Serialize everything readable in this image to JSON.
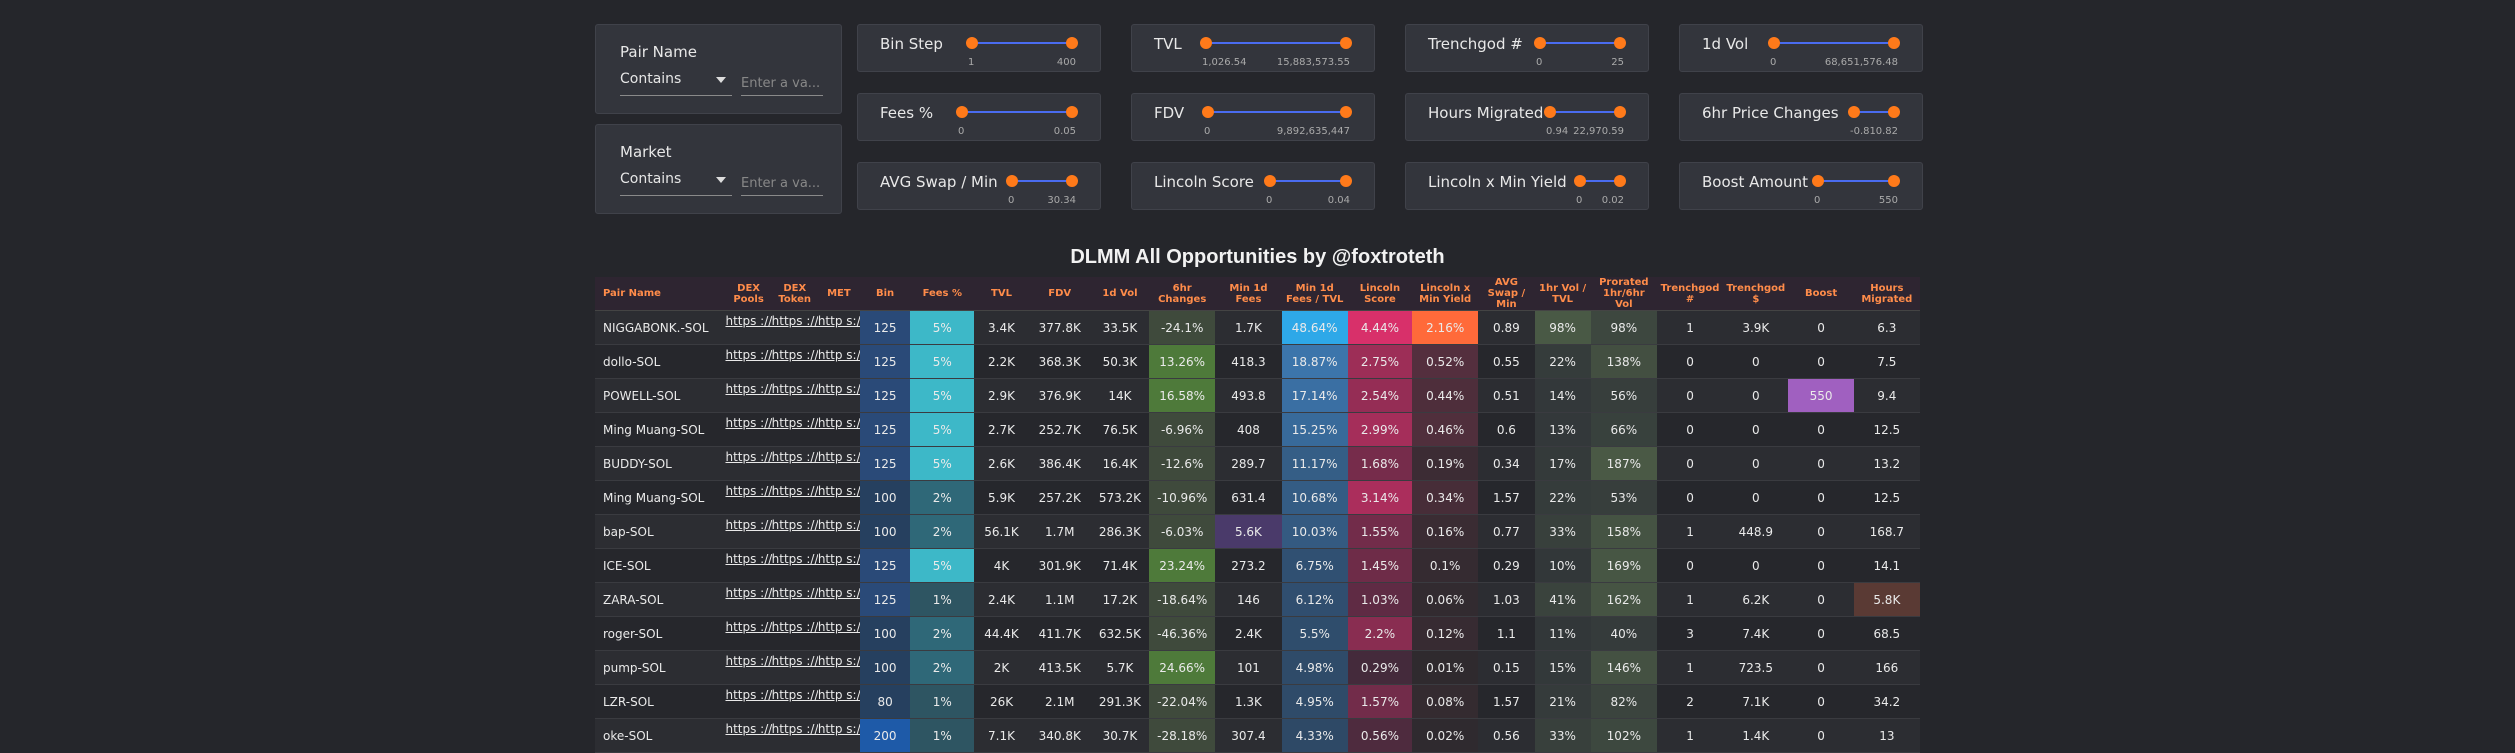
{
  "filters": [
    {
      "label": "Pair Name",
      "select": "Contains",
      "placeholder": "Enter a va..."
    },
    {
      "label": "Market",
      "select": "Contains",
      "placeholder": "Enter a va..."
    }
  ],
  "sliders": [
    {
      "label": "Bin Step",
      "min": "1",
      "max": "400"
    },
    {
      "label": "TVL",
      "min": "1,026.54",
      "max": "15,883,573.55"
    },
    {
      "label": "Trenchgod #",
      "min": "0",
      "max": "25"
    },
    {
      "label": "1d Vol",
      "min": "0",
      "max": "68,651,576.48"
    },
    {
      "label": "Fees %",
      "min": "0",
      "max": "0.05"
    },
    {
      "label": "FDV",
      "min": "0",
      "max": "9,892,635,447"
    },
    {
      "label": "Hours Migrated",
      "min": "0.94",
      "max": "22,970.59"
    },
    {
      "label": "6hr Price Changes",
      "min": "-0.81",
      "max": "0.82"
    },
    {
      "label": "AVG Swap / Min",
      "min": "0",
      "max": "30.34"
    },
    {
      "label": "Lincoln Score",
      "min": "0",
      "max": "0.04"
    },
    {
      "label": "Lincoln x Min Yield",
      "min": "0",
      "max": "0.02"
    },
    {
      "label": "Boost Amount",
      "min": "0",
      "max": "550"
    }
  ],
  "table_title": "DLMM All Opportunities by @foxtroteth",
  "columns": [
    "Pair Name",
    "DEX Pools",
    "DEX Token",
    "MET",
    "Bin",
    "Fees %",
    "TVL",
    "FDV",
    "1d Vol",
    "6hr Changes",
    "Min 1d Fees",
    "Min 1d Fees / TVL",
    "Lincoln Score",
    "Lincoln x Min Yield",
    "AVG Swap / Min",
    "1hr Vol / TVL",
    "Prorated 1hr/6hr Vol",
    "Trenchgod #",
    "Trenchgod $",
    "Boost",
    "Hours Migrated"
  ],
  "link_text": "https ://de",
  "met_text": "http s://a",
  "rows": [
    [
      "NIGGABONK.-SOL",
      "125",
      "5%",
      "3.4K",
      "377.8K",
      "33.5K",
      "-24.1%",
      "1.7K",
      "48.64%",
      "4.44%",
      "2.16%",
      "0.89",
      "98%",
      "98%",
      "1",
      "3.9K",
      "0",
      "6.3"
    ],
    [
      "dollo-SOL",
      "125",
      "5%",
      "2.2K",
      "368.3K",
      "50.3K",
      "13.26%",
      "418.3",
      "18.87%",
      "2.75%",
      "0.52%",
      "0.55",
      "22%",
      "138%",
      "0",
      "0",
      "0",
      "7.5"
    ],
    [
      "POWELL-SOL",
      "125",
      "5%",
      "2.9K",
      "376.9K",
      "14K",
      "16.58%",
      "493.8",
      "17.14%",
      "2.54%",
      "0.44%",
      "0.51",
      "14%",
      "56%",
      "0",
      "0",
      "550",
      "9.4"
    ],
    [
      "Ming Muang-SOL",
      "125",
      "5%",
      "2.7K",
      "252.7K",
      "76.5K",
      "-6.96%",
      "408",
      "15.25%",
      "2.99%",
      "0.46%",
      "0.6",
      "13%",
      "66%",
      "0",
      "0",
      "0",
      "12.5"
    ],
    [
      "BUDDY-SOL",
      "125",
      "5%",
      "2.6K",
      "386.4K",
      "16.4K",
      "-12.6%",
      "289.7",
      "11.17%",
      "1.68%",
      "0.19%",
      "0.34",
      "17%",
      "187%",
      "0",
      "0",
      "0",
      "13.2"
    ],
    [
      "Ming Muang-SOL",
      "100",
      "2%",
      "5.9K",
      "257.2K",
      "573.2K",
      "-10.96%",
      "631.4",
      "10.68%",
      "3.14%",
      "0.34%",
      "1.57",
      "22%",
      "53%",
      "0",
      "0",
      "0",
      "12.5"
    ],
    [
      "bap-SOL",
      "100",
      "2%",
      "56.1K",
      "1.7M",
      "286.3K",
      "-6.03%",
      "5.6K",
      "10.03%",
      "1.55%",
      "0.16%",
      "0.77",
      "33%",
      "158%",
      "1",
      "448.9",
      "0",
      "168.7"
    ],
    [
      "ICE-SOL",
      "125",
      "5%",
      "4K",
      "301.9K",
      "71.4K",
      "23.24%",
      "273.2",
      "6.75%",
      "1.45%",
      "0.1%",
      "0.29",
      "10%",
      "169%",
      "0",
      "0",
      "0",
      "14.1"
    ],
    [
      "ZARA-SOL",
      "125",
      "1%",
      "2.4K",
      "1.1M",
      "17.2K",
      "-18.64%",
      "146",
      "6.12%",
      "1.03%",
      "0.06%",
      "1.03",
      "41%",
      "162%",
      "1",
      "6.2K",
      "0",
      "5.8K"
    ],
    [
      "roger-SOL",
      "100",
      "2%",
      "44.4K",
      "411.7K",
      "632.5K",
      "-46.36%",
      "2.4K",
      "5.5%",
      "2.2%",
      "0.12%",
      "1.1",
      "11%",
      "40%",
      "3",
      "7.4K",
      "0",
      "68.5"
    ],
    [
      "pump-SOL",
      "100",
      "2%",
      "2K",
      "413.5K",
      "5.7K",
      "24.66%",
      "101",
      "4.98%",
      "0.29%",
      "0.01%",
      "0.15",
      "15%",
      "146%",
      "1",
      "723.5",
      "0",
      "166"
    ],
    [
      "LZR-SOL",
      "80",
      "1%",
      "26K",
      "2.1M",
      "291.3K",
      "-22.04%",
      "1.3K",
      "4.95%",
      "1.57%",
      "0.08%",
      "1.57",
      "21%",
      "82%",
      "2",
      "7.1K",
      "0",
      "34.2"
    ],
    [
      "oke-SOL",
      "200",
      "1%",
      "7.1K",
      "340.8K",
      "30.7K",
      "-28.18%",
      "307.4",
      "4.33%",
      "0.56%",
      "0.02%",
      "0.56",
      "33%",
      "102%",
      "1",
      "1.4K",
      "0",
      "13"
    ]
  ],
  "colors": {
    "bin": "#2a4a78",
    "bin_low": "#26405f",
    "bin_high": "#1e5aa8",
    "fees_5": "#3db8c8",
    "fees_2": "#2f6878",
    "fees_1": "#2e5562",
    "pos_change": "#4e7a3a",
    "neg_change": "#3a4a3a",
    "fees_tvl_high": "#2ea8e8",
    "lincoln_high": "#d2306a",
    "lincoln_mid": "#9a3560",
    "lincoln_low": "#5a3048",
    "lxm_high": "#ff6a3a",
    "boost_high": "#a060c0"
  }
}
